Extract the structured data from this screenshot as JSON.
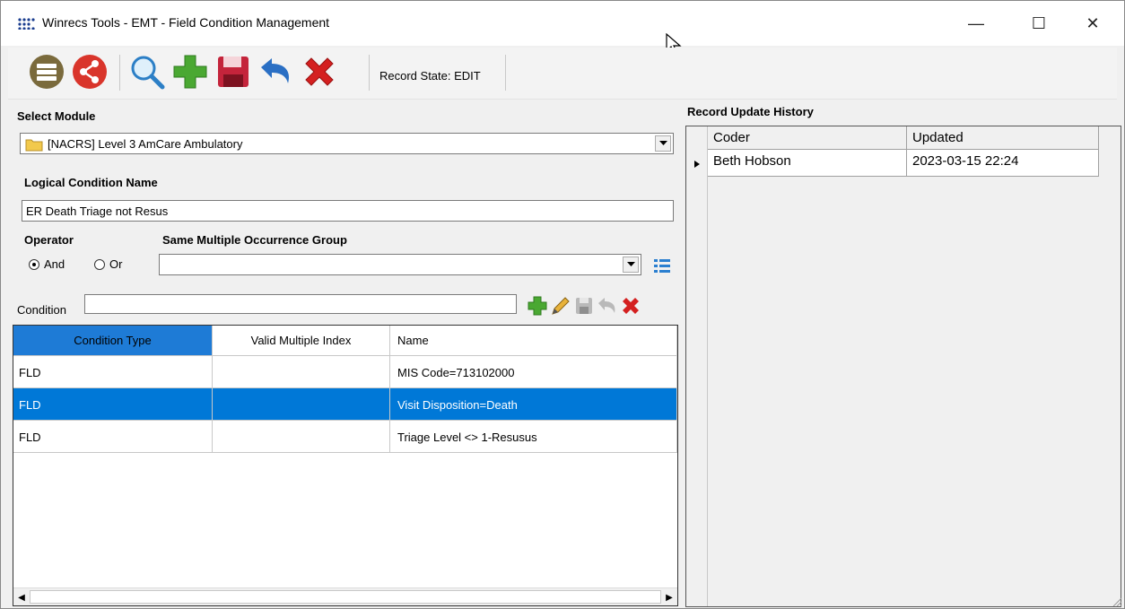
{
  "window": {
    "title": "Winrecs Tools - EMT - Field Condition Management",
    "minimize": "—",
    "maximize": "☐",
    "close": "✕"
  },
  "toolbar": {
    "record_state": "Record State: EDIT",
    "buttons": [
      "list-icon",
      "share-icon",
      "search-icon",
      "add-icon",
      "save-icon",
      "undo-icon",
      "delete-icon"
    ]
  },
  "module": {
    "label": "Select Module",
    "value": "[NACRS] Level 3 AmCare Ambulatory"
  },
  "logical_condition": {
    "label": "Logical Condition Name",
    "value": "ER Death Triage not Resus"
  },
  "operator": {
    "label": "Operator",
    "options": [
      "And",
      "Or"
    ],
    "selected": "And"
  },
  "group": {
    "label": "Same Multiple Occurrence Group",
    "value": ""
  },
  "condition": {
    "label": "Condition",
    "value": ""
  },
  "grid": {
    "columns": [
      "Condition Type",
      "Valid Multiple Index",
      "Name"
    ],
    "rows": [
      {
        "type": "FLD",
        "index": "",
        "name": "MIS Code=713102000"
      },
      {
        "type": "FLD",
        "index": "",
        "name": "Visit Disposition=Death"
      },
      {
        "type": "FLD",
        "index": "",
        "name": "Triage Level <> 1-Resusus"
      }
    ],
    "selected_row": 1
  },
  "history": {
    "label": "Record Update History",
    "columns": [
      "Coder",
      "Updated"
    ],
    "rows": [
      {
        "coder": "Beth Hobson",
        "updated": "2023-03-15 22:24"
      }
    ]
  },
  "colors": {
    "selection": "#0078d7",
    "header_active": "#1e7bd6"
  }
}
